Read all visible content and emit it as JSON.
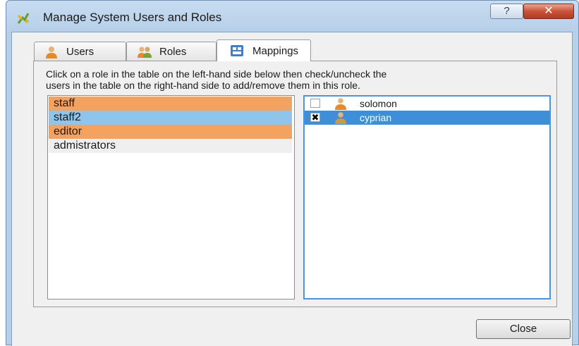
{
  "window": {
    "title": "Manage System Users and Roles",
    "help_label": "?",
    "close_label": "✕"
  },
  "tabs": [
    {
      "label": "Users",
      "icon": "user-icon",
      "active": false
    },
    {
      "label": "Roles",
      "icon": "roles-icon",
      "active": false
    },
    {
      "label": "Mappings",
      "icon": "mappings-icon",
      "active": true
    }
  ],
  "mappings": {
    "instructions_line1": "Click on a role in the table on the left-hand side below then check/uncheck the",
    "instructions_line2": "users in the table on the right-hand side to add/remove them in this role.",
    "roles": [
      {
        "name": "staff",
        "state": "highlighted"
      },
      {
        "name": "staff2",
        "state": "selected"
      },
      {
        "name": "editor",
        "state": "highlighted"
      },
      {
        "name": "admistrators",
        "state": "normal"
      }
    ],
    "users": [
      {
        "name": "solomon",
        "checked": false,
        "selected": false,
        "check_mark": ""
      },
      {
        "name": "cyprian",
        "checked": true,
        "selected": true,
        "check_mark": "✖"
      }
    ]
  },
  "footer": {
    "close_button_label": "Close"
  },
  "colors": {
    "role_highlight": "#f4a25f",
    "role_selected": "#8fc5ec",
    "user_selected": "#3e8fd7",
    "title_bar": "#c7dcf1",
    "close_button": "#c9543a"
  }
}
